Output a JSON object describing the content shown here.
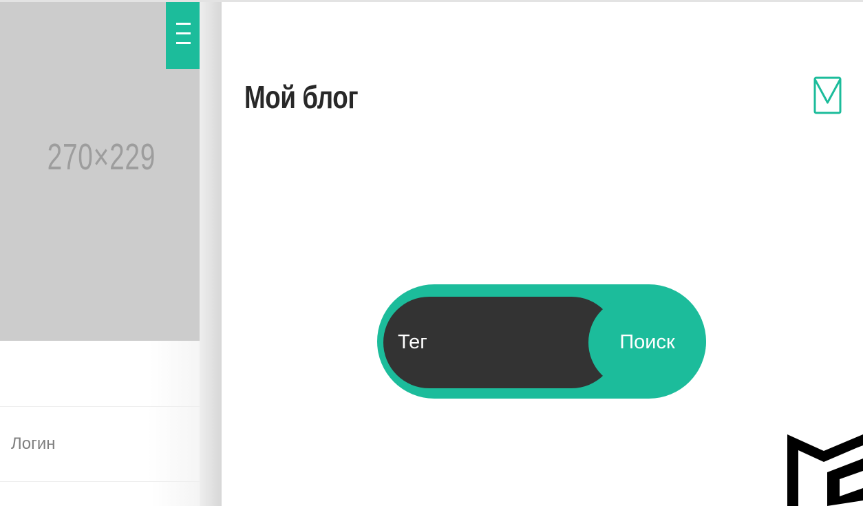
{
  "sidebar": {
    "image_placeholder": "270×229",
    "menu_icon": "hamburger-menu-icon",
    "login_placeholder": "Логин"
  },
  "main": {
    "title": "Мой блог",
    "mail_icon": "envelope-icon",
    "search": {
      "input_placeholder": "Тег",
      "button_label": "Поиск"
    },
    "logo": "corner-logo"
  },
  "colors": {
    "accent": "#1cbc9b",
    "dark": "#333333",
    "placeholder": "#cccccc",
    "title_text": "#282828"
  }
}
